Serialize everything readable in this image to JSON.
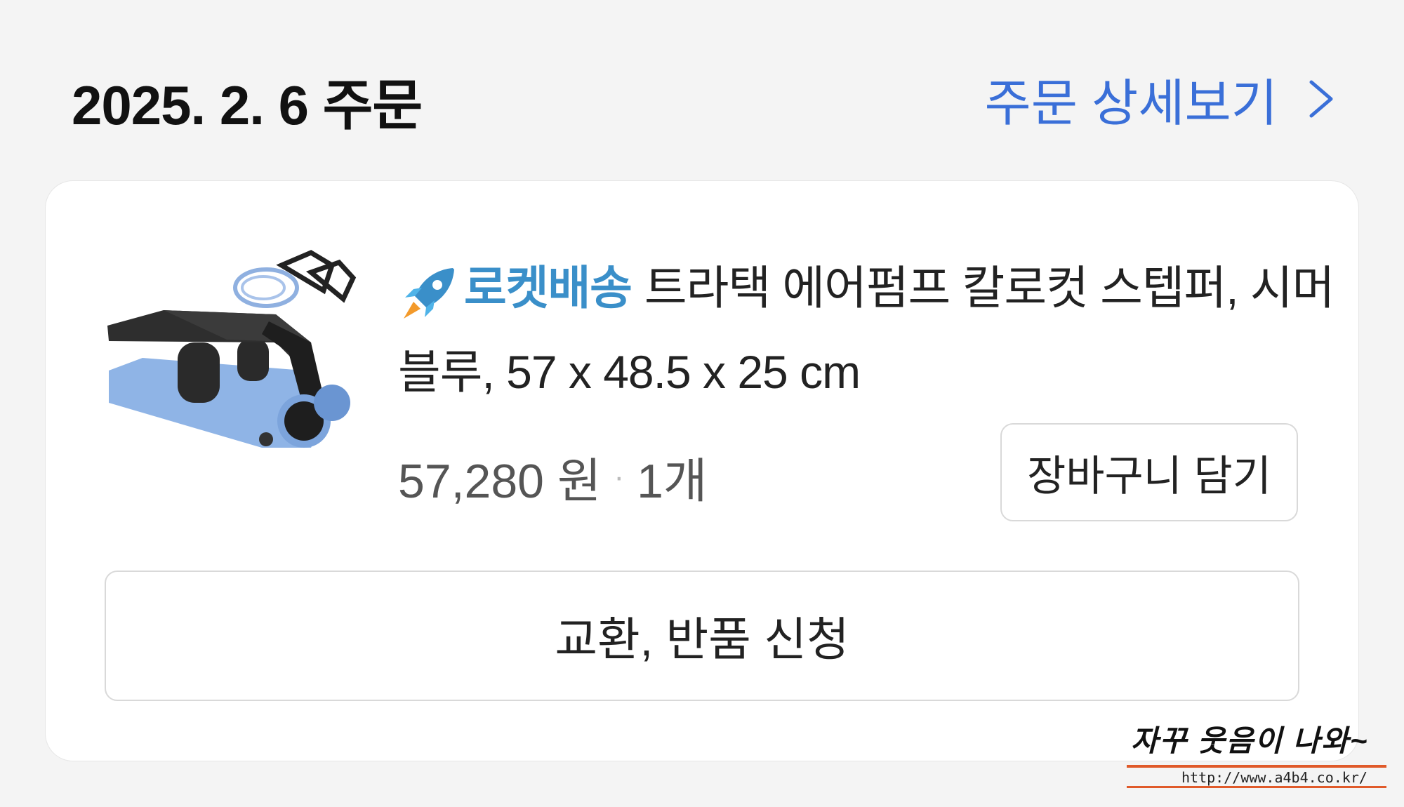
{
  "header": {
    "order_date": "2025. 2. 6 주문",
    "detail_link": "주문 상세보기"
  },
  "product": {
    "badge_label": "로켓배송",
    "title": "트라택 에어펌프 칼로컷 스텝퍼, 시머블루, 57 x 48.5 x 25 cm",
    "price": "57,280 원",
    "separator": "·",
    "quantity": "1개",
    "image_icon": "stepper-product-image"
  },
  "actions": {
    "add_to_cart": "장바구니 담기",
    "exchange_return": "교환, 반품 신청"
  },
  "watermark": {
    "text": "자꾸 웃음이 나와~",
    "url": "http://www.a4b4.co.kr/"
  },
  "colors": {
    "accent": "#3a6fd8",
    "rocket": "#3a8fc9",
    "background": "#f4f4f4"
  }
}
